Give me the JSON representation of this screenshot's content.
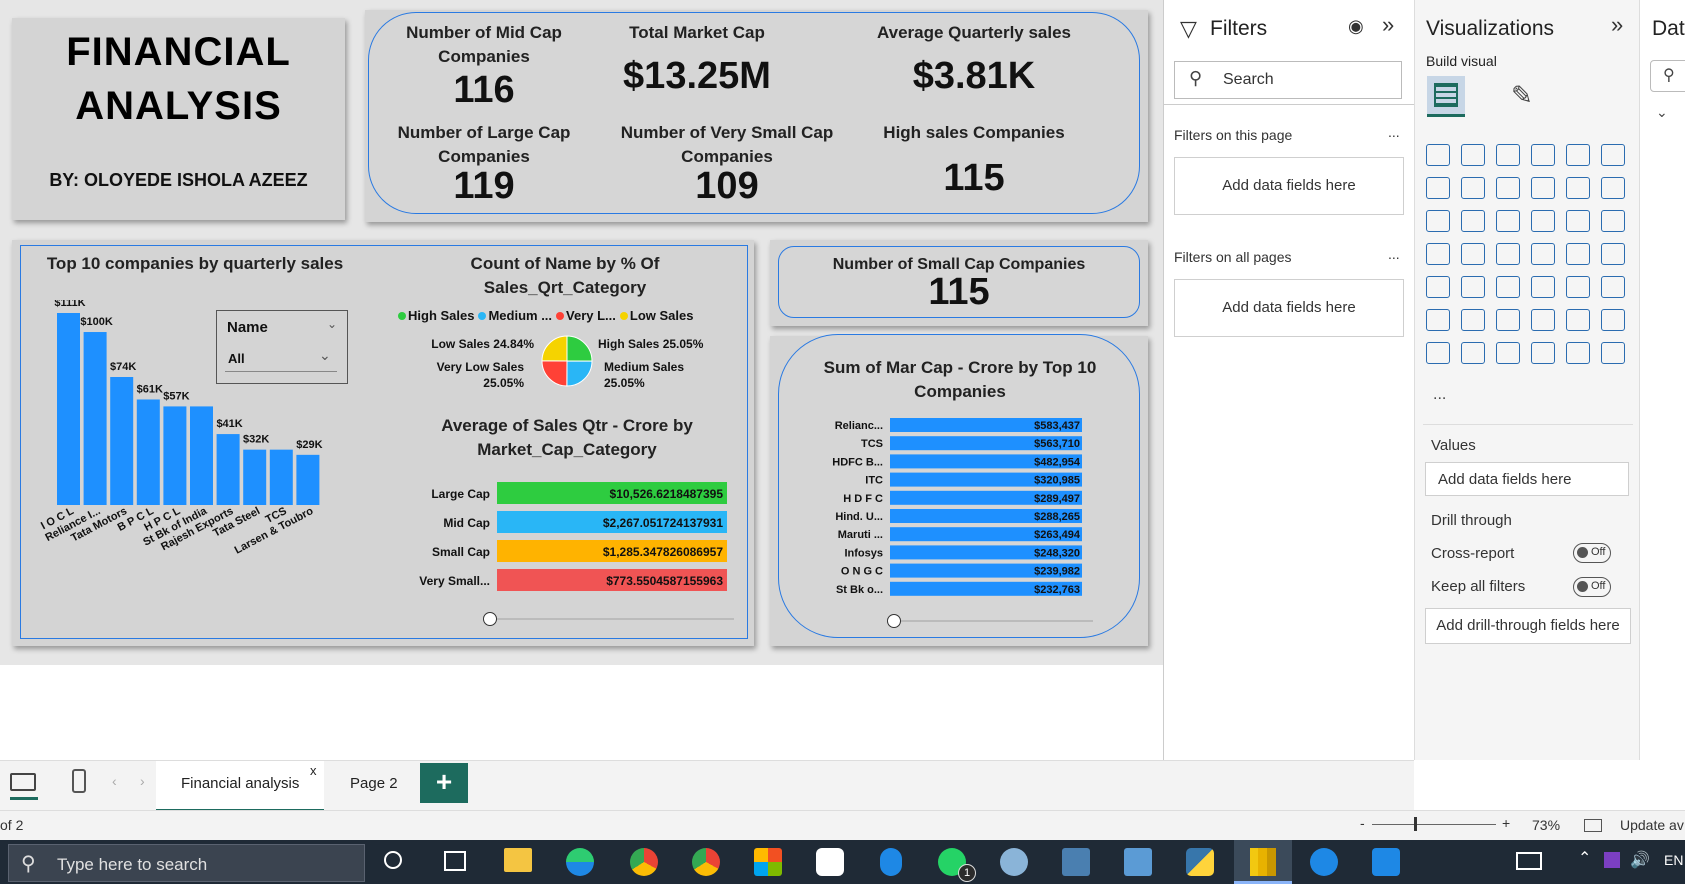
{
  "report": {
    "title_line1": "FINANCIAL",
    "title_line2": "ANALYSIS",
    "author": "BY: OLOYEDE ISHOLA AZEEZ",
    "kpis": {
      "mid_cap_label": "Number of Mid Cap Companies",
      "mid_cap_value": "116",
      "total_market_label": "Total Market Cap",
      "total_market_value": "$13.25M",
      "avg_quarterly_label": "Average Quarterly sales",
      "avg_quarterly_value": "$3.81K",
      "large_cap_label": "Number of Large Cap Companies",
      "large_cap_value": "119",
      "very_small_label": "Number of Very Small Cap Companies",
      "very_small_value": "109",
      "high_sales_label": "High sales Companies",
      "high_sales_value": "115",
      "small_cap_label": "Number of Small Cap Companies",
      "small_cap_value": "115"
    },
    "slicer": {
      "label": "Name",
      "value": "All"
    }
  },
  "chart_data": [
    {
      "type": "bar",
      "title": "Top 10 companies by quarterly sales",
      "categories": [
        "I O C L",
        "Reliance I...",
        "Tata Motors",
        "B P C L",
        "H P C L",
        "St Bk of India",
        "Rajesh Exports",
        "Tata Steel",
        "TCS",
        "Larsen & Toubro"
      ],
      "values": [
        111,
        100,
        74,
        61,
        57,
        57,
        41,
        32,
        32,
        29
      ],
      "data_labels": [
        "$111K",
        "$100K",
        "$74K",
        "$61K",
        "$57K",
        "",
        "$41K",
        "$32K",
        "",
        "$29K"
      ],
      "color": "#1e90ff",
      "ylim": [
        0,
        111
      ]
    },
    {
      "type": "pie",
      "title": "Count of Name by % Of Sales_Qrt_Category",
      "legend": [
        {
          "name": "High Sales",
          "color": "#2ecc40"
        },
        {
          "name": "Medium ...",
          "color": "#29b6f6"
        },
        {
          "name": "Very L...",
          "color": "#ff4136"
        },
        {
          "name": "Low Sales",
          "color": "#f5d300"
        }
      ],
      "slices": [
        {
          "name": "High Sales",
          "value": 25.05,
          "label": "High Sales 25.05%",
          "color": "#2ecc40"
        },
        {
          "name": "Medium Sales",
          "value": 25.05,
          "label": "Medium Sales 25.05%",
          "color": "#29b6f6"
        },
        {
          "name": "Very Low Sales",
          "value": 25.05,
          "label": "Very Low Sales 25.05%",
          "color": "#ff4136"
        },
        {
          "name": "Low Sales",
          "value": 24.84,
          "label": "Low Sales 24.84%",
          "color": "#f5d300"
        }
      ]
    },
    {
      "type": "bar",
      "title": "Average of Sales Qtr - Crore by Market_Cap_Category",
      "categories": [
        "Large Cap",
        "Mid Cap",
        "Small Cap",
        "Very Small..."
      ],
      "values": [
        10526.6218487395,
        2267.051724137931,
        1285.347826086957,
        773.5504587155963
      ],
      "data_labels": [
        "$10,526.6218487395",
        "$2,267.051724137931",
        "$1,285.347826086957",
        "$773.5504587155963"
      ],
      "colors": [
        "#2ecc40",
        "#29b6f6",
        "#ffb300",
        "#f05454"
      ]
    },
    {
      "type": "bar",
      "title": "Sum of Mar Cap - Crore by Top 10 Companies",
      "categories": [
        "Relianc...",
        "TCS",
        "HDFC B...",
        "ITC",
        "H D F C",
        "Hind. U...",
        "Maruti ...",
        "Infosys",
        "O N G C",
        "St Bk o..."
      ],
      "values": [
        583437,
        563710,
        482954,
        320985,
        289497,
        288265,
        263494,
        248320,
        239982,
        232763
      ],
      "data_labels": [
        "$583,437",
        "$563,710",
        "$482,954",
        "$320,985",
        "$289,497",
        "$288,265",
        "$263,494",
        "$248,320",
        "$239,982",
        "$232,763"
      ],
      "color": "#1e90ff"
    }
  ],
  "filters": {
    "title": "Filters",
    "search_placeholder": "Search",
    "on_page_label": "Filters on this page",
    "on_all_label": "Filters on all pages",
    "add_fields": "Add data fields here",
    "more": "..."
  },
  "viz": {
    "title": "Visualizations",
    "build_visual": "Build visual",
    "more": "...",
    "values_label": "Values",
    "add_fields": "Add data fields here",
    "drill_through": "Drill through",
    "cross_report": "Cross-report",
    "keep_all": "Keep all filters",
    "off": "Off",
    "add_drill": "Add drill-through fields here"
  },
  "data_pane": {
    "title": "Dat"
  },
  "tabs": {
    "active": "Financial analysis",
    "close": "x",
    "page2": "Page 2",
    "add": "+"
  },
  "status": {
    "page": "of 2",
    "zoom": "73%",
    "minus": "-",
    "plus": "+",
    "update": "Update av"
  },
  "taskbar": {
    "search_placeholder": "Type here to search",
    "lang": "EN",
    "badge": "1"
  }
}
